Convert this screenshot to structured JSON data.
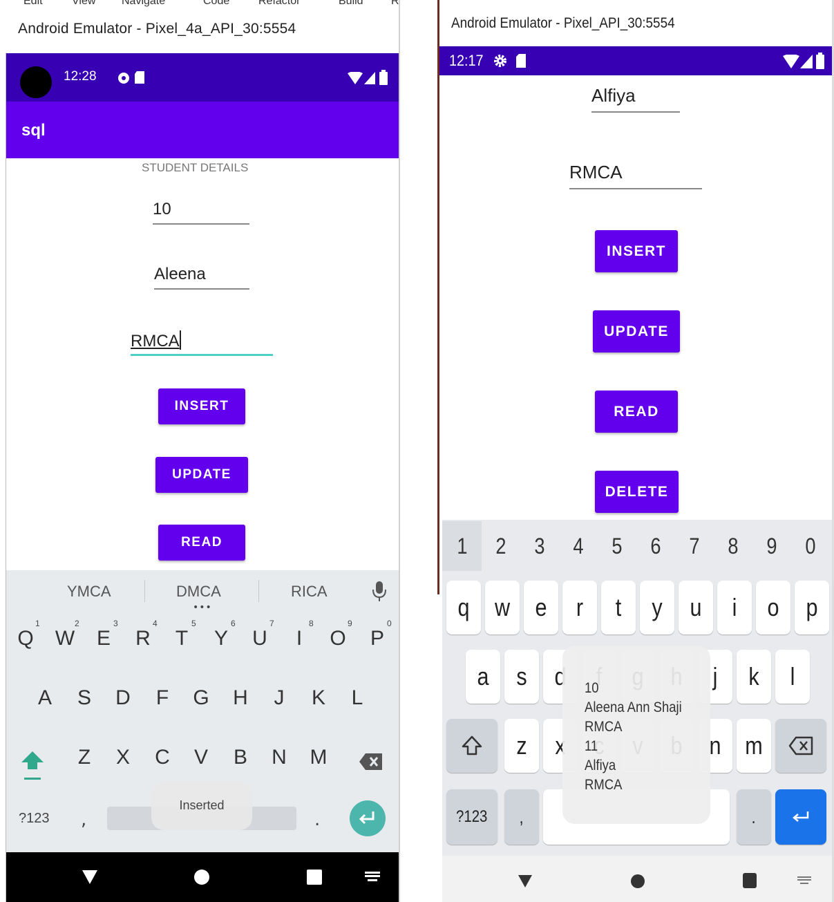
{
  "left": {
    "menu_items": [
      "Edit",
      "View",
      "Navigate",
      "Code",
      "Refactor",
      "Build",
      "R"
    ],
    "window_title": "Android Emulator - Pixel_4a_API_30:5554",
    "status_time": "12:28",
    "app_title": "sql",
    "heading": "STUDENT DETAILS",
    "fields": {
      "id": "10",
      "name": "Aleena",
      "course": "RMCA"
    },
    "buttons": {
      "insert": "INSERT",
      "update": "UPDATE",
      "read": "READ"
    },
    "suggestions": [
      "YMCA",
      "DMCA",
      "RICA"
    ],
    "keyboard": {
      "row1": [
        "Q",
        "W",
        "E",
        "R",
        "T",
        "Y",
        "U",
        "I",
        "O",
        "P"
      ],
      "row1_hints": [
        "1",
        "2",
        "3",
        "4",
        "5",
        "6",
        "7",
        "8",
        "9",
        "0"
      ],
      "row2": [
        "A",
        "S",
        "D",
        "F",
        "G",
        "H",
        "J",
        "K",
        "L"
      ],
      "row3": [
        "Z",
        "X",
        "C",
        "V",
        "B",
        "N",
        "M"
      ],
      "symbols": "?123",
      "comma": ",",
      "period": "."
    },
    "toast": "Inserted"
  },
  "right": {
    "window_title": "Android Emulator - Pixel_API_30:5554",
    "status_time": "12:17",
    "fields": {
      "name": "Alfiya",
      "course": "RMCA"
    },
    "buttons": {
      "insert": "INSERT",
      "update": "UPDATE",
      "read": "READ",
      "delete": "DELETE"
    },
    "keyboard": {
      "numbers": [
        "1",
        "2",
        "3",
        "4",
        "5",
        "6",
        "7",
        "8",
        "9",
        "0"
      ],
      "row1": [
        "q",
        "w",
        "e",
        "r",
        "t",
        "y",
        "u",
        "i",
        "o",
        "p"
      ],
      "row2": [
        "a",
        "s",
        "d",
        "f",
        "g",
        "h",
        "j",
        "k",
        "l"
      ],
      "row3": [
        "z",
        "x",
        "c",
        "v",
        "b",
        "n",
        "m"
      ],
      "symbols": "?123",
      "comma": ",",
      "period": "."
    },
    "toast_lines": [
      "10",
      "Aleena Ann Shaji",
      "RMCA",
      "11",
      "Alfiya",
      "RMCA"
    ]
  },
  "colors": {
    "status_bar": "#3700b3",
    "primary": "#6200ee",
    "accent": "#4fd1c5",
    "enter_left": "#4db6ac",
    "enter_right": "#1a73e8"
  }
}
